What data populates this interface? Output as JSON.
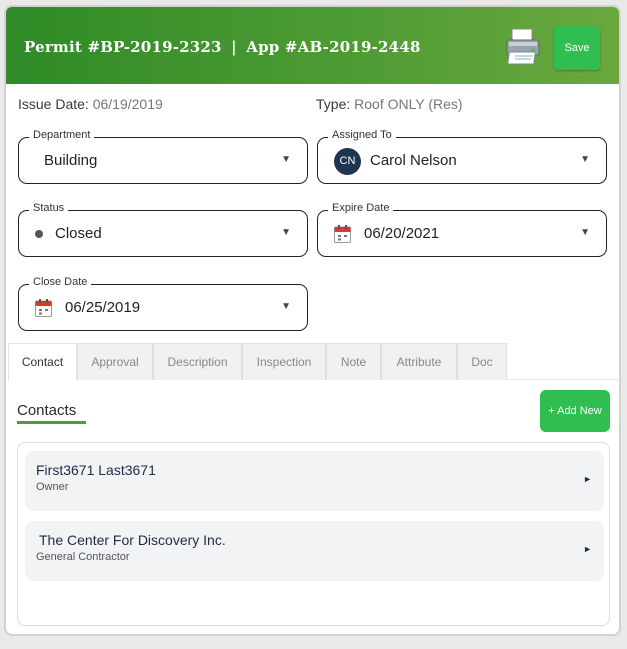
{
  "header": {
    "permit_label": "Permit #BP-2019-2323",
    "separator": "|",
    "app_label": "App #AB-2019-2448",
    "save_label": "Save",
    "bg_color": "#3a8f2c"
  },
  "info": {
    "issue_label": "Issue Date:",
    "issue_value": "06/19/2019",
    "type_label": "Type:",
    "type_value": "Roof ONLY (Res)"
  },
  "fields": {
    "department": {
      "label": "Department",
      "value": "Building"
    },
    "assigned_to": {
      "label": "Assigned To",
      "initials": "CN",
      "value": "Carol Nelson"
    },
    "status": {
      "label": "Status",
      "value": "Closed"
    },
    "expire_date": {
      "label": "Expire Date",
      "value": "06/20/2021"
    },
    "close_date": {
      "label": "Close Date",
      "value": "06/25/2019"
    }
  },
  "caret_icon": "▼",
  "tabs": [
    "Contact",
    "Approval",
    "Description",
    "Inspection",
    "Note",
    "Attribute",
    "Doc"
  ],
  "active_tab": "Contact",
  "contacts": {
    "title": "Contacts",
    "add_label": "+ Add New",
    "items": [
      {
        "name": "First3671 Last3671",
        "role": "Owner"
      },
      {
        "name": "The Center For Discovery Inc.",
        "role": "General Contractor"
      }
    ],
    "arrow_icon": "►"
  },
  "colors": {
    "accent_green": "#2fbe4f",
    "underline_green": "#3ea24a",
    "avatar_navy": "#1f3550"
  }
}
